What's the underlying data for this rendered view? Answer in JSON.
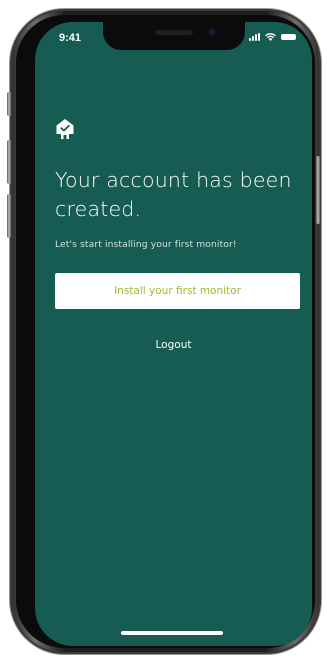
{
  "status_bar": {
    "time": "9:41",
    "icons": [
      "cellular-signal-icon",
      "wifi-icon",
      "battery-icon"
    ]
  },
  "brand": {
    "logo_icon": "house-checkmark-icon",
    "colors": {
      "background": "#165c52",
      "button_text": "#9bbd2e",
      "button_background": "#ffffff"
    }
  },
  "onboarding": {
    "title": "Your account has been created.",
    "subtitle": "Let's start installing your first monitor!",
    "install_button_label": "Install your first monitor",
    "logout_label": "Logout"
  }
}
